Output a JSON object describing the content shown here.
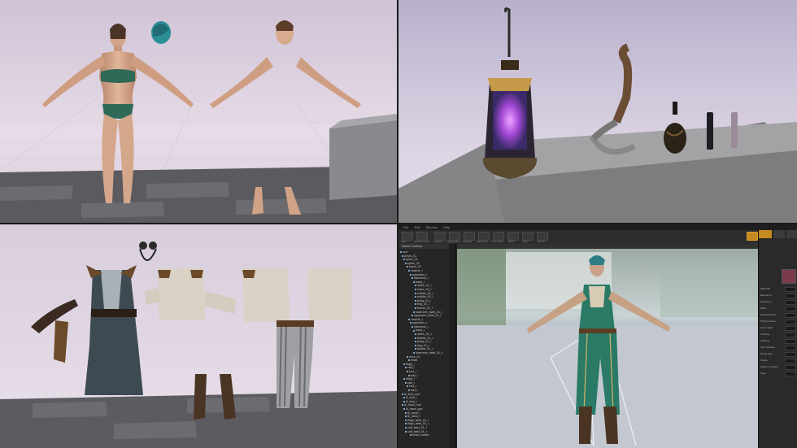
{
  "editor": {
    "menu": [
      "File",
      "Edit",
      "Window",
      "Help"
    ],
    "toolbar_buttons": [
      "Save",
      "Source Control",
      "Content",
      "Marketplace",
      "Settings",
      "Blueprints",
      "Cinematics",
      "Build",
      "Play",
      "Launch"
    ],
    "outliner_title": "World Outliner",
    "tree_items": [
      "root",
      "pelvis_01",
      "spine_01",
      "spine_02",
      "spine_03",
      "clavicle_l",
      "upperarm_l",
      "lowerarm_l",
      "hand_l",
      "index_01_l",
      "index_02_l",
      "middle_01_l",
      "middle_02_l",
      "pinky_01_l",
      "ring_01_l",
      "thumb_01_l",
      "lowerarm_twist_01_l",
      "upperarm_twist_01_l",
      "clavicle_r",
      "upperarm_r",
      "lowerarm_r",
      "hand_r",
      "index_01_r",
      "middle_01_r",
      "pinky_01_r",
      "ring_01_r",
      "thumb_01_r",
      "lowerarm_twist_01_r",
      "neck_01",
      "head",
      "thigh_l",
      "calf_l",
      "foot_l",
      "ball_l",
      "thigh_r",
      "calf_r",
      "foot_r",
      "ball_r",
      "ik_foot_root",
      "ik_foot_l",
      "ik_foot_r",
      "ik_hand_root",
      "ik_hand_gun",
      "ik_hand_l",
      "ik_hand_r",
      "thigh_twist_01_l",
      "thigh_twist_01_r",
      "calf_twist_01_l",
      "calf_twist_01_r",
      "head_socket"
    ],
    "details_rows": [
      "Materials",
      "Element 0",
      "Element 1",
      "Mesh",
      "Skeletal Mesh",
      "Physics Asset",
      "Anim Class",
      "Clothing",
      "Lighting",
      "Cast Shadow",
      "Rendering",
      "Visible",
      "Hidden in Game",
      "Tags"
    ]
  }
}
